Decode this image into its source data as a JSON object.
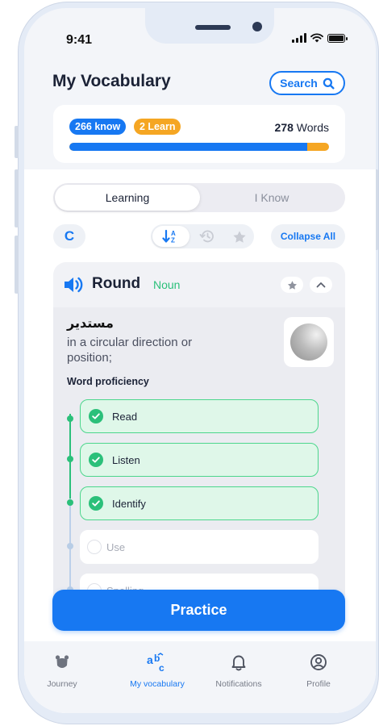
{
  "status_bar": {
    "time": "9:41"
  },
  "header": {
    "title": "My Vocabulary",
    "search_label": "Search"
  },
  "progress": {
    "know_label": "266 know",
    "learn_label": "2 Learn",
    "word_count": "278",
    "word_unit": "Words",
    "known_fraction": 0.915
  },
  "tabs": {
    "learning": "Learning",
    "i_know": "I Know"
  },
  "filters": {
    "letter": "C",
    "collapse_all": "Collapse All"
  },
  "word_card": {
    "word": "Round",
    "part_of_speech": "Noun",
    "translation": "مستدير",
    "definition": "in a circular direction or position;",
    "proficiency_title": "Word proficiency",
    "steps": [
      {
        "label": "Read",
        "done": true
      },
      {
        "label": "Listen",
        "done": true
      },
      {
        "label": "Identify",
        "done": true
      },
      {
        "label": "Use",
        "done": false
      },
      {
        "label": "Spelling",
        "done": false
      }
    ]
  },
  "practice_button": "Practice",
  "bottom_nav": {
    "journey": "Journey",
    "my_vocabulary": "My vocabulary",
    "notifications": "Notifications",
    "profile": "Profile"
  },
  "colors": {
    "accent": "#1778f2",
    "learn": "#f5a623",
    "success": "#2bc07a"
  }
}
